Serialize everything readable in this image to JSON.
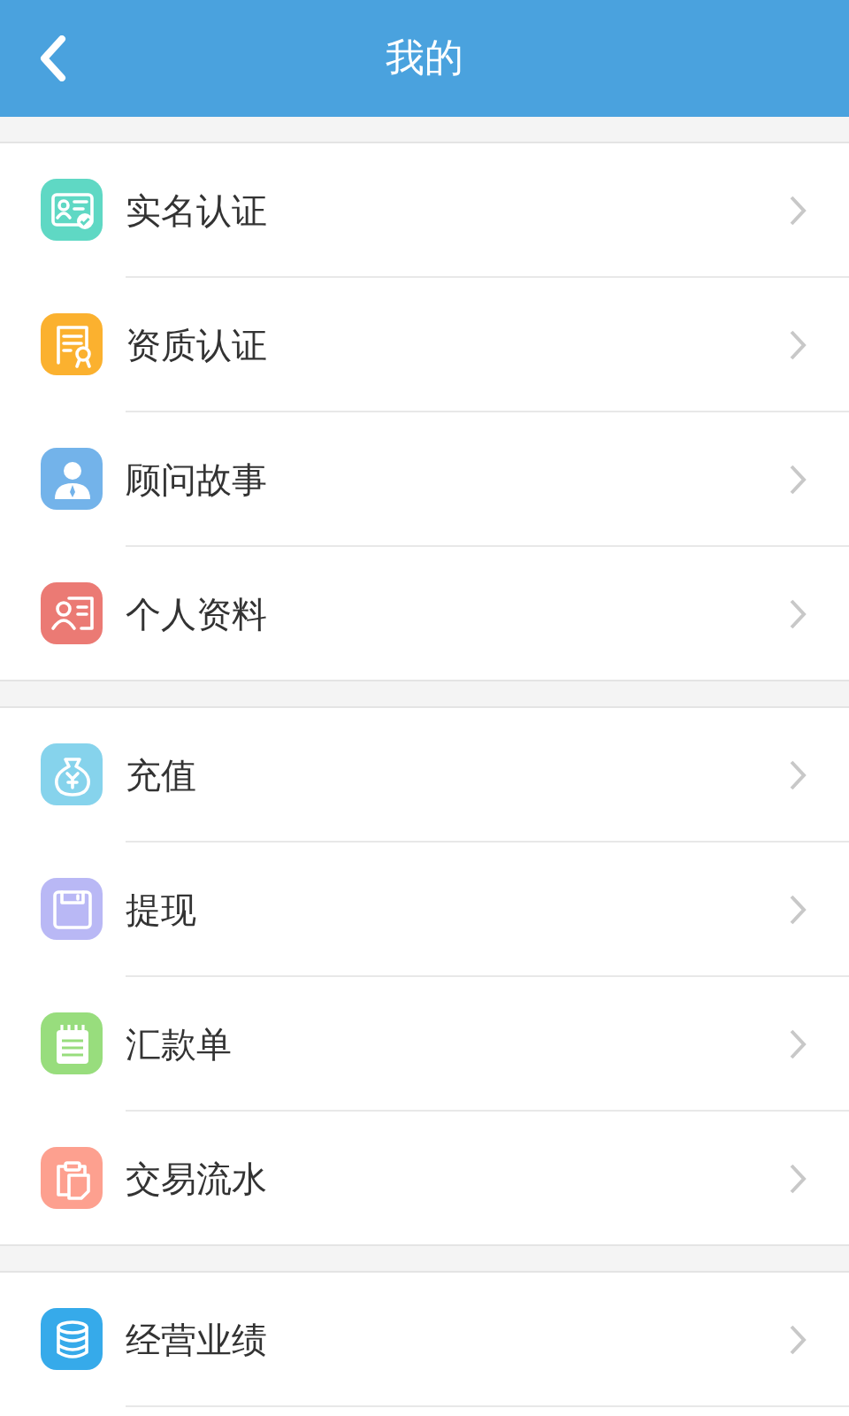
{
  "header": {
    "title": "我的"
  },
  "groups": [
    {
      "items": [
        {
          "label": "实名认证",
          "kind": "id-card",
          "color": "#5fd8c4"
        },
        {
          "label": "资质认证",
          "kind": "certificate",
          "color": "#fbb12f"
        },
        {
          "label": "顾问故事",
          "kind": "person",
          "color": "#73b3ea"
        },
        {
          "label": "个人资料",
          "kind": "profile",
          "color": "#eb7a74"
        }
      ]
    },
    {
      "items": [
        {
          "label": "充值",
          "kind": "money-bag",
          "color": "#86d3ec"
        },
        {
          "label": "提现",
          "kind": "floppy",
          "color": "#b9b8f5"
        },
        {
          "label": "汇款单",
          "kind": "notepad",
          "color": "#98dd7d"
        },
        {
          "label": "交易流水",
          "kind": "clipboard",
          "color": "#fda08f"
        }
      ]
    },
    {
      "items": [
        {
          "label": "经营业绩",
          "kind": "database",
          "color": "#36aaea"
        }
      ]
    }
  ]
}
